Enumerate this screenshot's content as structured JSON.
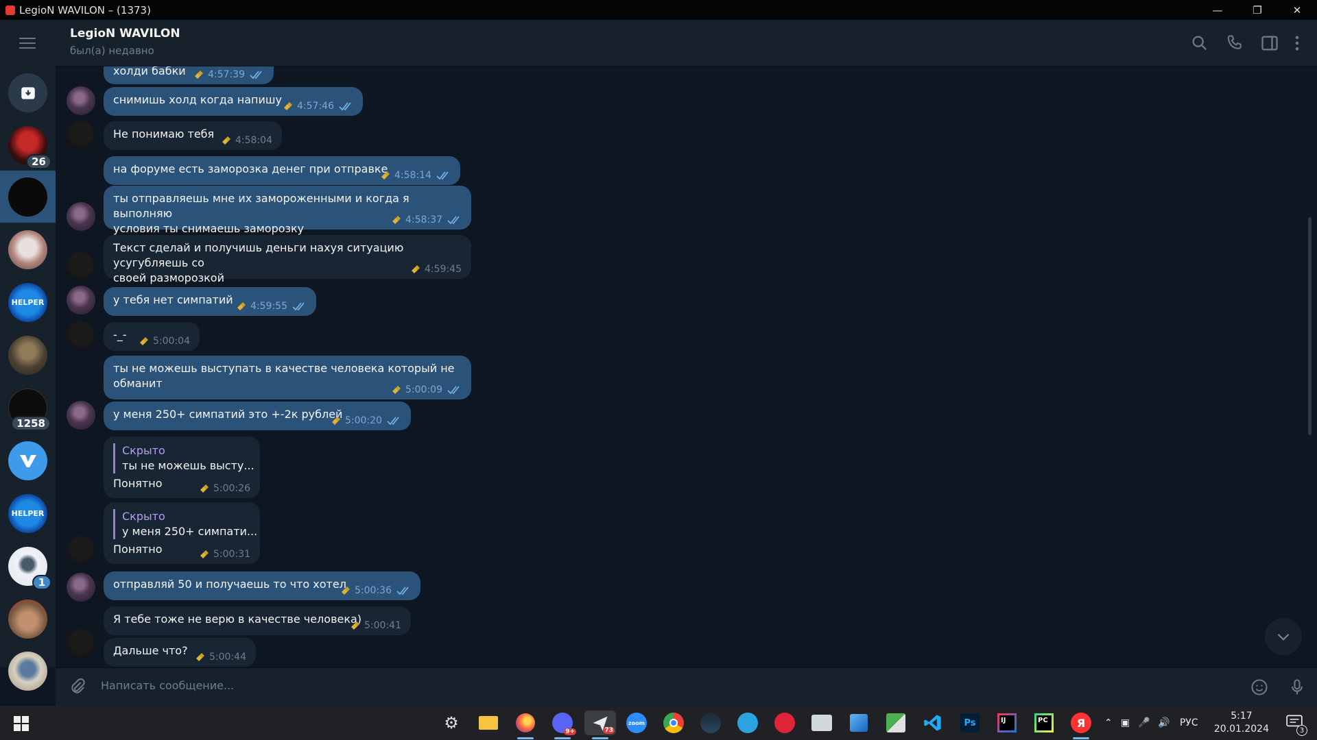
{
  "window": {
    "title": "LegioN WAVILON – (1373)"
  },
  "sidebar": {
    "chats": [
      {
        "name": "archive",
        "badge": ""
      },
      {
        "name": "chat-netflix",
        "badge": "26"
      },
      {
        "name": "chat-active",
        "badge": ""
      },
      {
        "name": "chat-3",
        "badge": ""
      },
      {
        "name": "chat-helper",
        "badge": ""
      },
      {
        "name": "chat-5",
        "badge": ""
      },
      {
        "name": "chat-vpn",
        "badge": "1258"
      },
      {
        "name": "chat-7",
        "badge": ""
      },
      {
        "name": "chat-helper-2",
        "badge": ""
      },
      {
        "name": "chat-9",
        "badge": "1"
      },
      {
        "name": "chat-10",
        "badge": ""
      },
      {
        "name": "chat-11",
        "badge": ""
      }
    ]
  },
  "header": {
    "name": "LegioN WAVILON",
    "status": "был(а) недавно"
  },
  "messages": [
    {
      "dir": "out",
      "text": "холди бабки",
      "time": "4:57:39",
      "read": true
    },
    {
      "dir": "out",
      "text": "снимишь холд когда напишу",
      "time": "4:57:46",
      "read": true
    },
    {
      "dir": "in",
      "text": "Не понимаю тебя",
      "time": "4:58:04"
    },
    {
      "dir": "out",
      "text": "на форуме есть заморозка денег при отправке",
      "time": "4:58:14",
      "read": true
    },
    {
      "dir": "out",
      "text": "ты отправляешь мне их замороженными и когда я выполняю\nусловия ты снимаешь заморозку",
      "time": "4:58:37",
      "read": true
    },
    {
      "dir": "in",
      "text": "Текст сделай и получишь деньги нахуя ситуацию усугубляешь со\nсвоей разморозкой",
      "time": "4:59:45"
    },
    {
      "dir": "out",
      "text": "у тебя нет симпатий",
      "time": "4:59:55",
      "read": true
    },
    {
      "dir": "in",
      "text": "-_-",
      "time": "5:00:04"
    },
    {
      "dir": "out",
      "text": "ты не можешь выступать в качестве человека который не\nобманит",
      "time": "5:00:09",
      "read": true
    },
    {
      "dir": "out",
      "text": "у меня 250+ симпатий это +-2к рублей",
      "time": "5:00:20",
      "read": true
    },
    {
      "dir": "in",
      "reply_name": "Скрыто",
      "reply_text": "ты не можешь высту...",
      "text": "Понятно",
      "time": "5:00:26"
    },
    {
      "dir": "in",
      "reply_name": "Скрыто",
      "reply_text": "у меня 250+ симпати...",
      "text": "Понятно",
      "time": "5:00:31"
    },
    {
      "dir": "out",
      "text": "отправляй 50 и получаешь то что хотел",
      "time": "5:00:36",
      "read": true
    },
    {
      "dir": "in",
      "text": "Я тебе тоже не верю в качестве человека)",
      "time": "5:00:41"
    },
    {
      "dir": "in",
      "text": "Дальше что?",
      "time": "5:00:44"
    }
  ],
  "composer": {
    "placeholder": "Написать сообщение..."
  },
  "taskbar": {
    "apps": [
      "settings",
      "file-explorer",
      "firefox",
      "discord",
      "telegram-active",
      "zoom",
      "chrome",
      "steam",
      "telegram",
      "adobe",
      "photos",
      "network",
      "translate",
      "vscode",
      "photoshop",
      "intellij",
      "pycharm",
      "yandex"
    ],
    "telegram_badge": "73",
    "discord_badge": "9+",
    "language": "РУС",
    "time": "5:17",
    "date": "20.01.2024",
    "notifications": "3"
  }
}
